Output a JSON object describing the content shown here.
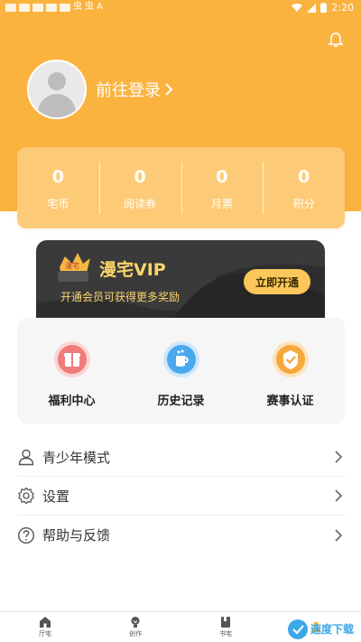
{
  "status_bar": {
    "time": "2:20",
    "left_glyphs": [
      "虫",
      "虫",
      "A"
    ]
  },
  "header": {
    "login_text": "前往登录"
  },
  "stats": [
    {
      "value": "0",
      "label": "宅币"
    },
    {
      "value": "0",
      "label": "阅读券"
    },
    {
      "value": "0",
      "label": "月票"
    },
    {
      "value": "0",
      "label": "积分"
    }
  ],
  "vip": {
    "title": "漫宅VIP",
    "subtitle": "开通会员可获得更多奖励",
    "button": "立即开通",
    "logo_text": "漫宅"
  },
  "features": [
    {
      "label": "福利中心",
      "icon": "gift-icon",
      "color": "#f07b7b"
    },
    {
      "label": "历史记录",
      "icon": "history-icon",
      "color": "#4aa8ee"
    },
    {
      "label": "赛事认证",
      "icon": "badge-icon",
      "color": "#f7a83c"
    }
  ],
  "menu": [
    {
      "label": "青少年模式",
      "icon": "person-icon"
    },
    {
      "label": "设置",
      "icon": "gear-icon"
    },
    {
      "label": "帮助与反馈",
      "icon": "question-icon"
    }
  ],
  "bottom_nav": [
    {
      "label": "厅宅",
      "icon": "home-icon"
    },
    {
      "label": "创作",
      "icon": "bulb-icon"
    },
    {
      "label": "书宅",
      "icon": "book-icon"
    },
    {
      "label": "",
      "icon": "profile-icon"
    }
  ],
  "watermark": {
    "text": "速度下载"
  },
  "colors": {
    "accent": "#fbb33f",
    "vip_dark": "#3a3a3a",
    "vip_gold": "#fbd56a"
  }
}
